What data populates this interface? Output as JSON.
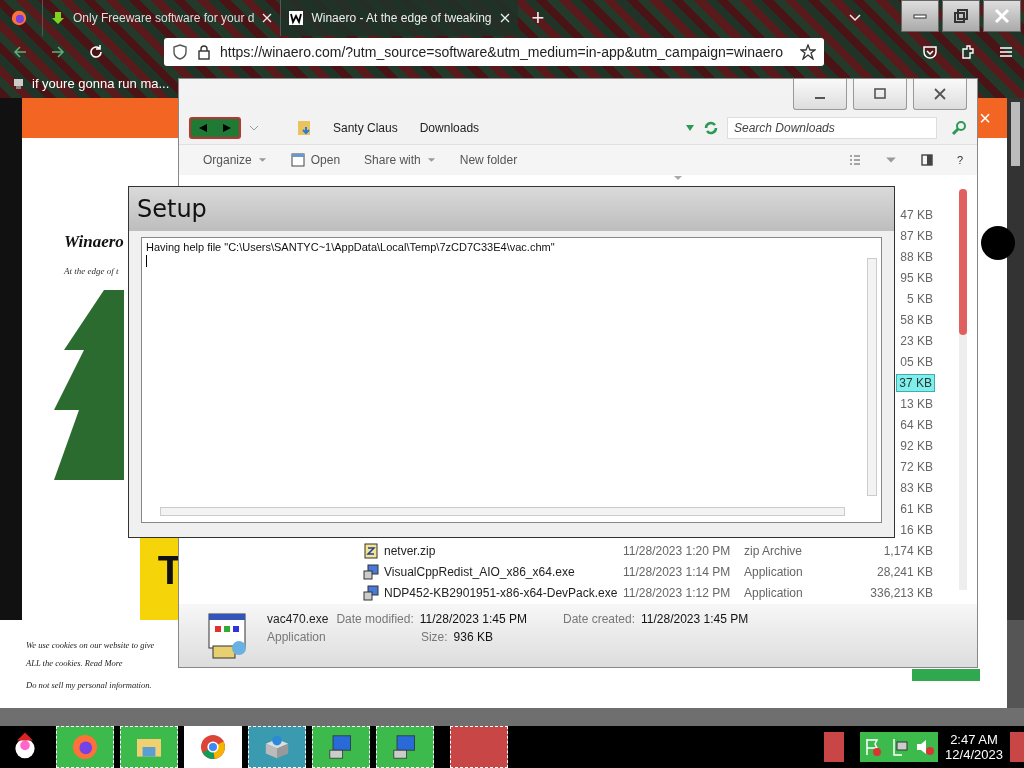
{
  "browser": {
    "tabs": [
      {
        "title": "Only Freeware software for your d",
        "selected": false
      },
      {
        "title": "Winaero - At the edge of tweaking",
        "selected": true
      }
    ],
    "new_tab": "+",
    "url": "https://winaero.com/?utm_source=software&utm_medium=in-app&utm_campaign=winaero",
    "bookmark": "if youre gonna run ma..."
  },
  "webpage": {
    "close": "×",
    "logo": "Winaero",
    "tagline": "At the edge of t",
    "headline_letter": "T",
    "cookie_lines": [
      "We use cookies on our website to give",
      "ALL the cookies. Read More",
      "Do not sell my personal information."
    ]
  },
  "explorer": {
    "breadcrumb": [
      "Santy Claus",
      "Downloads"
    ],
    "search_placeholder": "Search Downloads",
    "toolbar": [
      {
        "label": "Organize",
        "kind": "menu"
      },
      {
        "label": "Open",
        "kind": "icon"
      },
      {
        "label": "Share with",
        "kind": "menu"
      },
      {
        "label": "New folder",
        "kind": "plain"
      }
    ],
    "help": "?",
    "files": [
      {
        "size": "47 KB",
        "selected": false
      },
      {
        "size": "87 KB",
        "selected": false
      },
      {
        "size": "88 KB",
        "selected": false
      },
      {
        "size": "95 KB",
        "selected": false
      },
      {
        "size": "5 KB",
        "selected": false
      },
      {
        "size": "58 KB",
        "selected": false
      },
      {
        "size": "23 KB",
        "selected": false
      },
      {
        "size": "05 KB",
        "selected": false
      },
      {
        "size": "37 KB",
        "selected": true
      },
      {
        "size": "13 KB",
        "selected": false
      },
      {
        "size": "64 KB",
        "selected": false
      },
      {
        "size": "92 KB",
        "selected": false
      },
      {
        "size": "72 KB",
        "selected": false
      },
      {
        "size": "83 KB",
        "selected": false
      },
      {
        "size": "61 KB",
        "selected": false
      },
      {
        "size": "16 KB",
        "selected": false
      },
      {
        "name": "netver.zip",
        "date": "11/28/2023 1:20 PM",
        "type": "zip Archive",
        "size": "1,174 KB",
        "selected": false,
        "kind": "zip"
      },
      {
        "name": "VisualCppRedist_AIO_x86_x64.exe",
        "date": "11/28/2023 1:14 PM",
        "type": "Application",
        "size": "28,241 KB",
        "selected": false,
        "kind": "exe"
      },
      {
        "name": "NDP452-KB2901951-x86-x64-DevPack.exe",
        "date": "11/28/2023 1:12 PM",
        "type": "Application",
        "size": "336,213 KB",
        "selected": false,
        "kind": "exe"
      }
    ],
    "details": {
      "name": "vac470.exe",
      "type": "Application",
      "modified_label": "Date modified:",
      "modified": "11/28/2023 1:45 PM",
      "created_label": "Date created:",
      "created": "11/28/2023 1:45 PM",
      "size_label": "Size:",
      "size": "936 KB"
    }
  },
  "setup": {
    "title": "Setup",
    "log": "Having help file \"C:\\Users\\SANTYC~1\\AppData\\Local\\Temp\\7zCD7C33E4\\vac.chm\""
  },
  "taskbar": {
    "time": "2:47 AM",
    "date": "12/4/2023"
  }
}
